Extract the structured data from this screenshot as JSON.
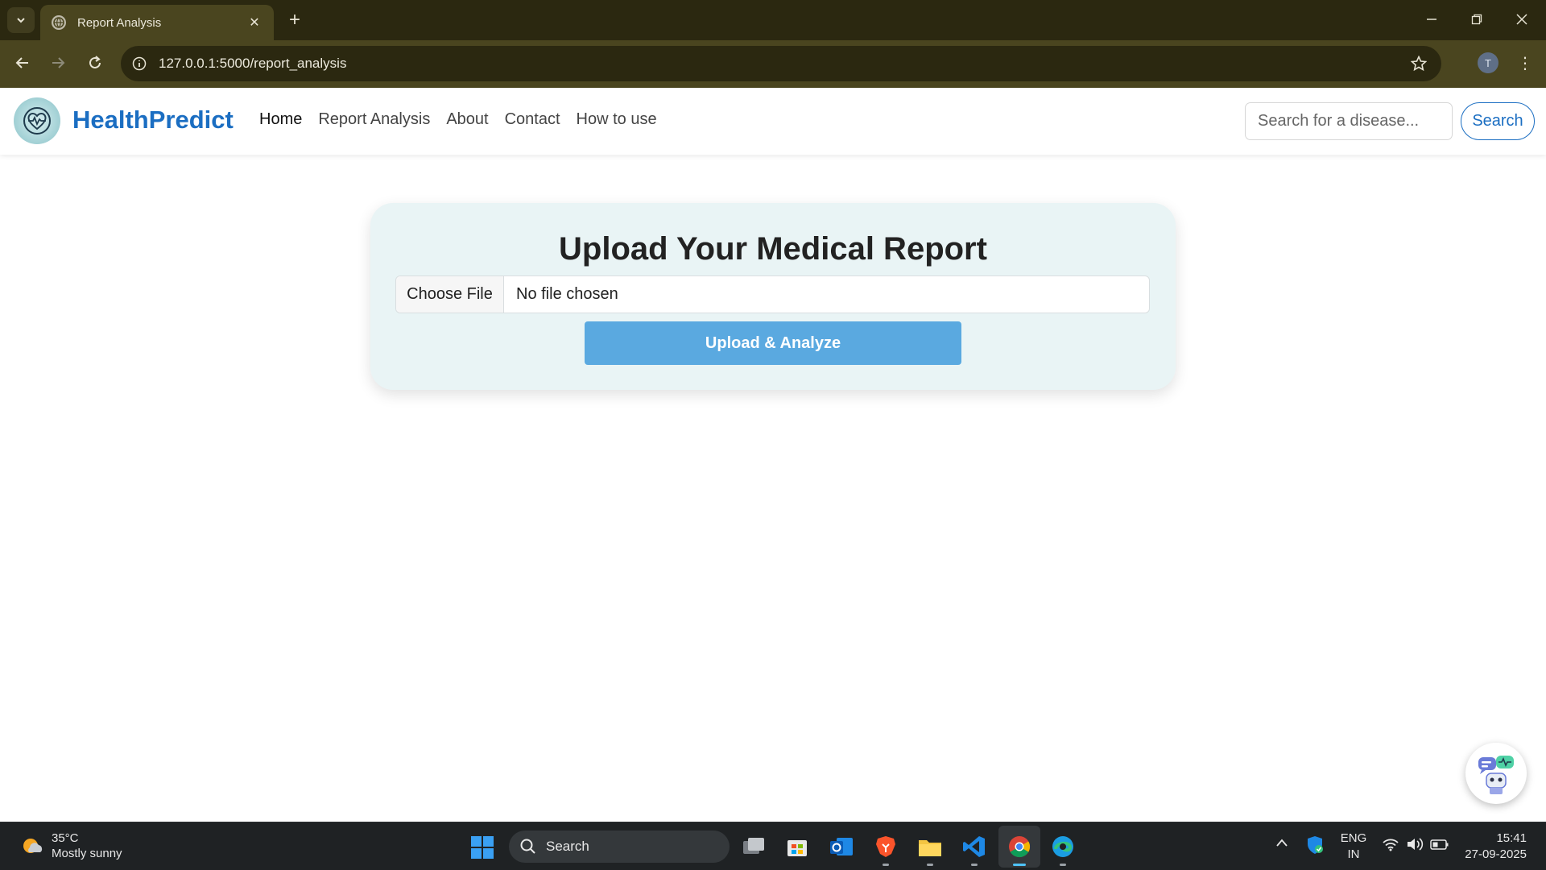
{
  "browser": {
    "tab_title": "Report Analysis",
    "url": "127.0.0.1:5000/report_analysis",
    "profile_initial": "T"
  },
  "site": {
    "brand": "HealthPredict",
    "nav": [
      "Home",
      "Report Analysis",
      "About",
      "Contact",
      "How to use"
    ],
    "search_placeholder": "Search for a disease...",
    "search_button": "Search",
    "accent": "#1b6ec2"
  },
  "upload": {
    "heading": "Upload Your Medical Report",
    "choose_file": "Choose File",
    "file_status": "No file chosen",
    "button": "Upload & Analyze"
  },
  "taskbar": {
    "weather_temp": "35°C",
    "weather_desc": "Mostly sunny",
    "search_label": "Search",
    "lang": "ENG",
    "region": "IN",
    "time": "15:41",
    "date": "27-09-2025"
  }
}
